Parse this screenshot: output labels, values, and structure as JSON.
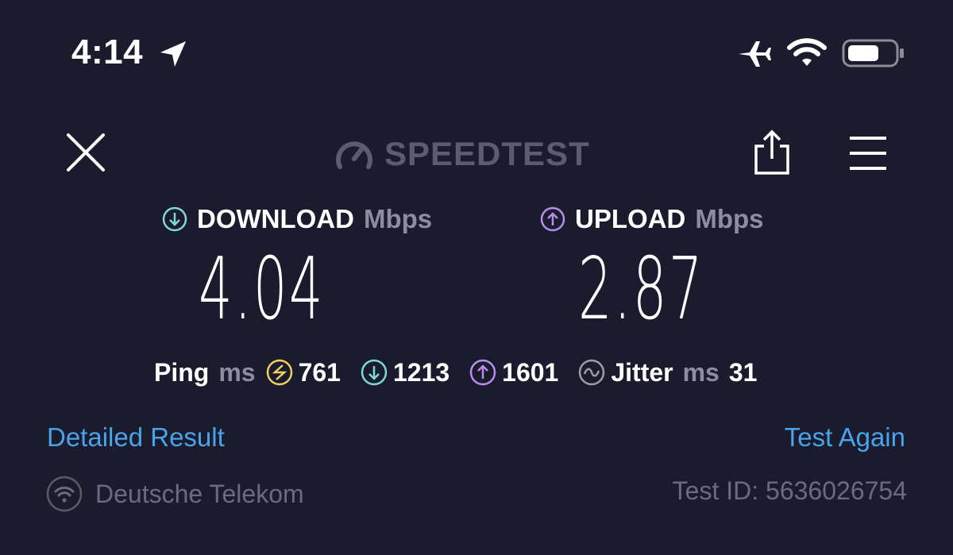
{
  "status_bar": {
    "time": "4:14"
  },
  "header": {
    "logo_text": "SPEEDTEST"
  },
  "download": {
    "label": "DOWNLOAD",
    "unit": "Mbps",
    "value": "4.04",
    "color": "#7fd9d0"
  },
  "upload": {
    "label": "UPLOAD",
    "unit": "Mbps",
    "value": "2.87",
    "color": "#b98cf0"
  },
  "ping": {
    "label": "Ping",
    "unit": "ms",
    "idle": "761",
    "download": "1213",
    "upload": "1601",
    "jitter_label": "Jitter",
    "jitter_unit": "ms",
    "jitter": "31",
    "idle_color": "#f0d060"
  },
  "actions": {
    "detailed_result": "Detailed Result",
    "test_again": "Test Again"
  },
  "footer": {
    "provider": "Deutsche Telekom",
    "test_id": "Test ID: 5636026754"
  },
  "colors": {
    "background": "#1a1c2e",
    "link": "#4aa3e8"
  }
}
